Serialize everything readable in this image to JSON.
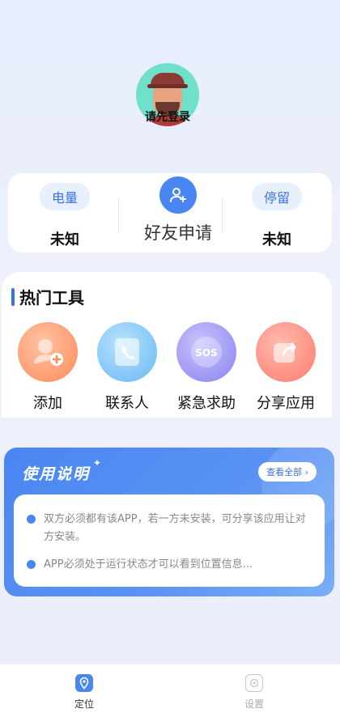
{
  "profile": {
    "login_text": "请先登录"
  },
  "status": {
    "battery_label": "电量",
    "battery_value": "未知",
    "friend_request_label": "好友申请",
    "stay_label": "停留",
    "stay_value": "未知"
  },
  "tools": {
    "title": "热门工具",
    "items": [
      {
        "label": "添加",
        "icon": "add-user-icon"
      },
      {
        "label": "联系人",
        "icon": "contacts-icon"
      },
      {
        "label": "紧急求助",
        "icon": "sos-icon",
        "badge": "SOS"
      },
      {
        "label": "分享应用",
        "icon": "share-icon"
      }
    ]
  },
  "instructions": {
    "title": "使用说明",
    "view_all": "查看全部 ›",
    "items": [
      "双方必须都有该APP，若一方未安装，可分享该应用让对方安装。",
      "APP必须处于运行状态才可以看到位置信息..."
    ]
  },
  "nav": {
    "items": [
      {
        "label": "定位",
        "icon": "location-icon",
        "active": true
      },
      {
        "label": "设置",
        "icon": "settings-icon",
        "active": false
      }
    ]
  },
  "colors": {
    "accent": "#4a86f2",
    "background": "#e6edfd"
  }
}
